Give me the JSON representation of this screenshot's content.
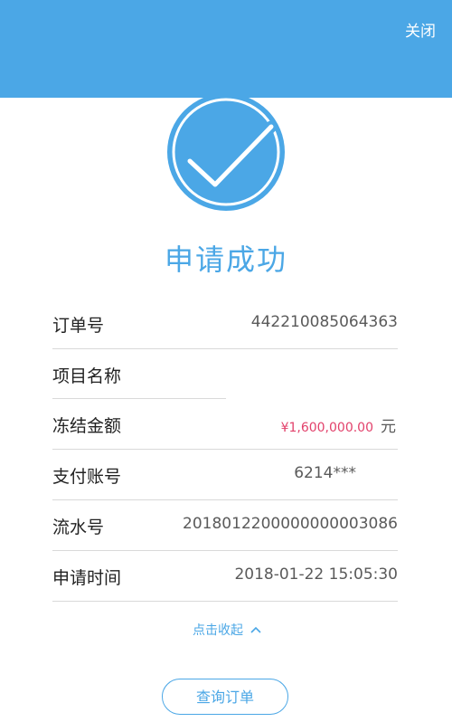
{
  "header": {
    "close_label": "关闭",
    "color": "#4ba7e6"
  },
  "status": {
    "icon": "check-circle-icon",
    "title": "申请成功"
  },
  "details": [
    {
      "label": "订单号",
      "value": "442210085064363"
    },
    {
      "label": "项目名称",
      "value": ""
    },
    {
      "label": "冻结金额",
      "value": "¥1,600,000.00",
      "unit": "元"
    },
    {
      "label": "支付账号",
      "value": "6214***"
    },
    {
      "label": "流水号",
      "value": "2018012200000000003086"
    },
    {
      "label": "申请时间",
      "value": "2018-01-22 15:05:30"
    }
  ],
  "collapse_label": "点击收起",
  "query_button_label": "查询订单",
  "colors": {
    "accent": "#4ba7e6",
    "amount": "#e2416b"
  }
}
